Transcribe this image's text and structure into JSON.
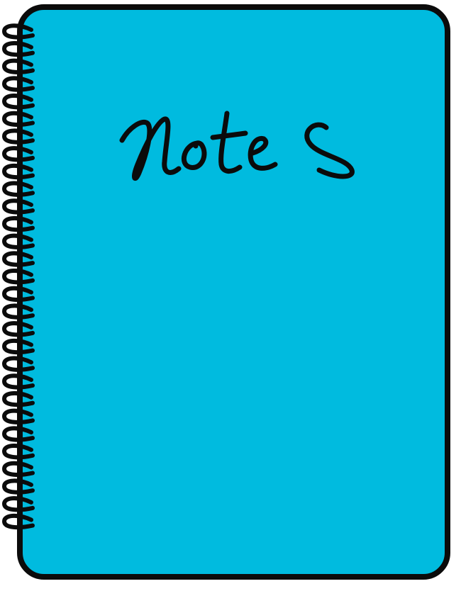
{
  "cover": {
    "title": "Notes",
    "cover_color": "#00bbdf",
    "outline_color": "#0b0b0b"
  },
  "binding": {
    "type": "spiral",
    "coil_icon": "spiral-coil-icon"
  }
}
